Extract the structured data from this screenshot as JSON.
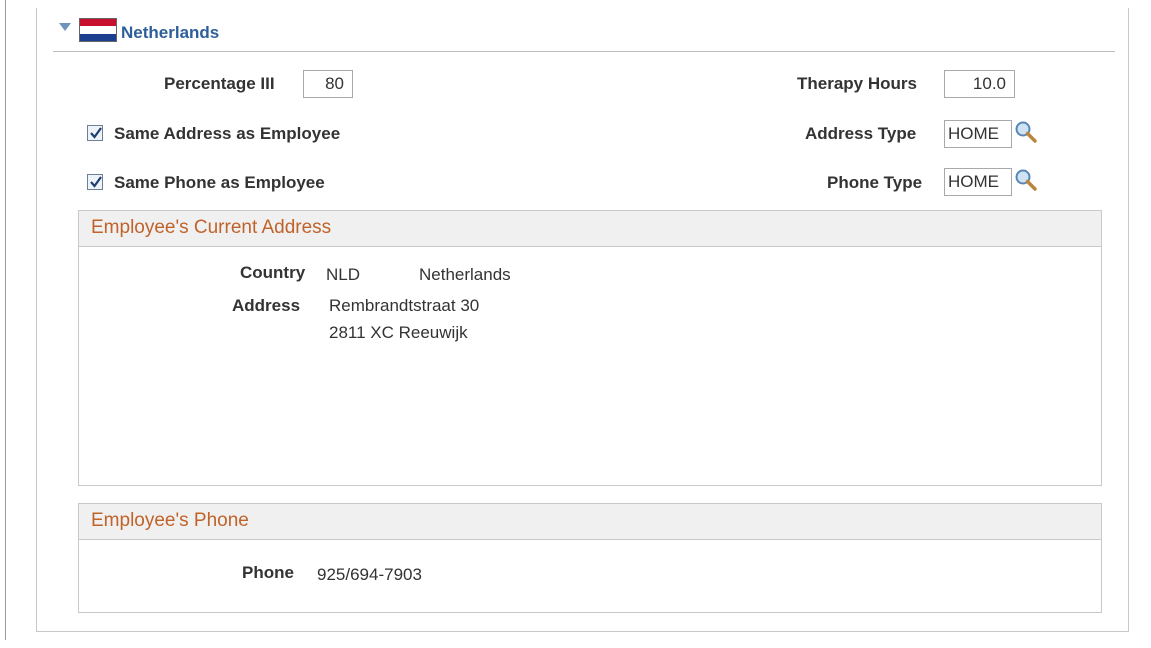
{
  "section": {
    "title": "Netherlands"
  },
  "fields": {
    "percentage_label": "Percentage III",
    "percentage_value": "80",
    "therapy_label": "Therapy Hours",
    "therapy_value": "10.0",
    "same_address_label": "Same Address as Employee",
    "same_address_checked": true,
    "same_phone_label": "Same Phone as Employee",
    "same_phone_checked": true,
    "address_type_label": "Address Type",
    "address_type_value": "HOME",
    "phone_type_label": "Phone Type",
    "phone_type_value": "HOME"
  },
  "address_box": {
    "title": "Employee's Current Address",
    "country_label": "Country",
    "country_code": "NLD",
    "country_name": "Netherlands",
    "address_label": "Address",
    "address_line1": "Rembrandtstraat 30",
    "address_line2": "2811 XC Reeuwijk"
  },
  "phone_box": {
    "title": "Employee's Phone",
    "phone_label": "Phone",
    "phone_value": "925/694-7903"
  },
  "icons": {
    "collapse": "triangle-down-icon",
    "flag": "netherlands-flag-icon",
    "lookup": "magnifier-icon",
    "checkbox": "checkmark-icon"
  },
  "colors": {
    "section_title": "#2d5f9a",
    "group_title": "#c0632a",
    "group_header_bg": "#f0f0f0"
  }
}
